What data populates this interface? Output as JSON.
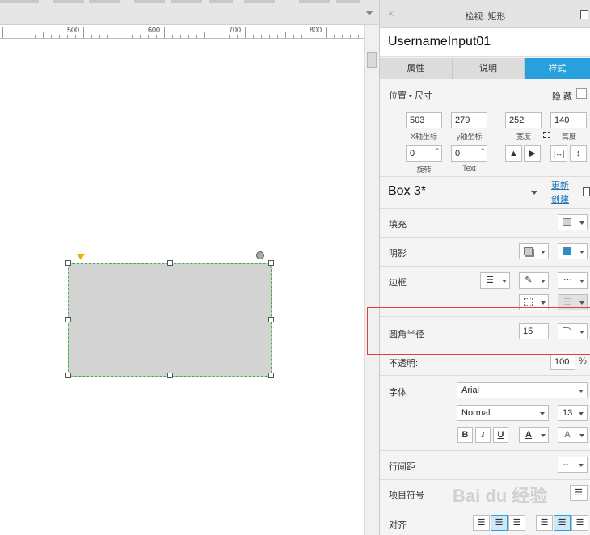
{
  "ruler": {
    "labels": [
      "500",
      "600",
      "700",
      "800"
    ]
  },
  "panel": {
    "title": "检视: 矩形",
    "element_name": "UsernameInput01",
    "tabs": [
      {
        "label": "属性",
        "active": false
      },
      {
        "label": "说明",
        "active": false
      },
      {
        "label": "样式",
        "active": true
      }
    ],
    "position_size": {
      "title": "位置 • 尺寸",
      "hidden_label": "隐 藏",
      "x": {
        "value": "503",
        "label": "X轴坐标"
      },
      "y": {
        "value": "279",
        "label": "y轴坐标"
      },
      "width": {
        "value": "252",
        "label": "宽度"
      },
      "height": {
        "value": "140",
        "label": "高度"
      },
      "rotation": {
        "value": "0",
        "unit": "°",
        "label": "旋转"
      },
      "text_rotation": {
        "value": "0",
        "unit": "°",
        "label": "Text"
      }
    },
    "style": {
      "name": "Box 3*",
      "update_link": "更新",
      "create_link": "创建"
    },
    "fill": {
      "label": "填充",
      "color": "#d3d3d3"
    },
    "shadow": {
      "label": "阴影",
      "color": "#2a8fc2"
    },
    "border": {
      "label": "边框"
    },
    "corner_radius": {
      "label": "圆角半径",
      "value": "15"
    },
    "opacity": {
      "label": "不透明:",
      "value": "100",
      "unit": "%"
    },
    "font": {
      "label": "字体",
      "family": "Arial",
      "weight": "Normal",
      "size": "13",
      "bold": "B",
      "italic": "I",
      "underline": "U",
      "color_glyph": "A",
      "effect_glyph": "A"
    },
    "line_spacing": {
      "label": "行间距",
      "value": "--"
    },
    "bullet": {
      "label": "项目符号"
    },
    "align": {
      "label": "对齐"
    }
  },
  "watermark": "Bai du 经验",
  "colors": {
    "accent": "#29a0de",
    "highlight": "#e04040",
    "selection": "#3cb043"
  }
}
